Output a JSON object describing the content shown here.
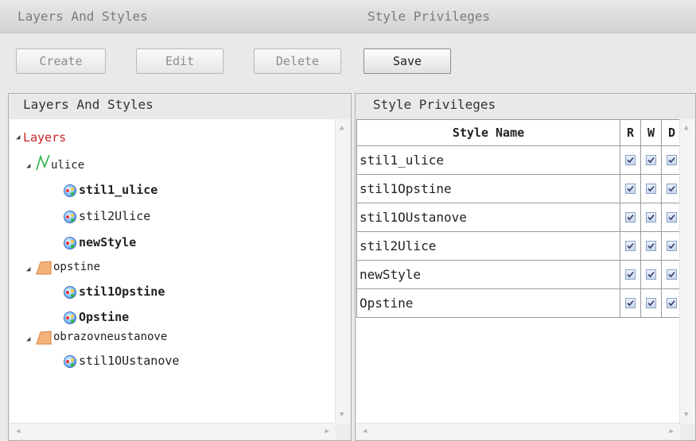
{
  "headers": {
    "left": "Layers And Styles",
    "right": "Style Privileges"
  },
  "toolbar": {
    "create": "Create",
    "edit": "Edit",
    "delete": "Delete",
    "save": "Save"
  },
  "left_panel": {
    "title": "Layers And Styles",
    "root": "Layers",
    "layers": [
      {
        "name": "ulice",
        "icon": "line-layer-icon",
        "styles": [
          "stil1_ulice",
          "stil2Ulice",
          "newStyle"
        ]
      },
      {
        "name": "opstine",
        "icon": "polygon-layer-icon",
        "styles": [
          "stil1Opstine",
          "Opstine"
        ]
      },
      {
        "name": "obrazovneustanove",
        "icon": "polygon-layer-icon",
        "styles": [
          "stil1OUstanove"
        ]
      }
    ]
  },
  "right_panel": {
    "title": "Style Privileges",
    "columns": [
      "Style Name",
      "R",
      "W",
      "D"
    ],
    "rows": [
      {
        "name": "stil1_ulice",
        "R": true,
        "W": true,
        "D": true
      },
      {
        "name": "stil1Opstine",
        "R": true,
        "W": true,
        "D": true
      },
      {
        "name": "stil1OUstanove",
        "R": true,
        "W": true,
        "D": true
      },
      {
        "name": "stil2Ulice",
        "R": true,
        "W": true,
        "D": true
      },
      {
        "name": "newStyle",
        "R": true,
        "W": true,
        "D": true
      },
      {
        "name": "Opstine",
        "R": true,
        "W": true,
        "D": true
      }
    ]
  },
  "colors": {
    "root_label": "#cc2222",
    "line_icon": "#2bb54a",
    "polygon_icon": "#f0a060"
  }
}
